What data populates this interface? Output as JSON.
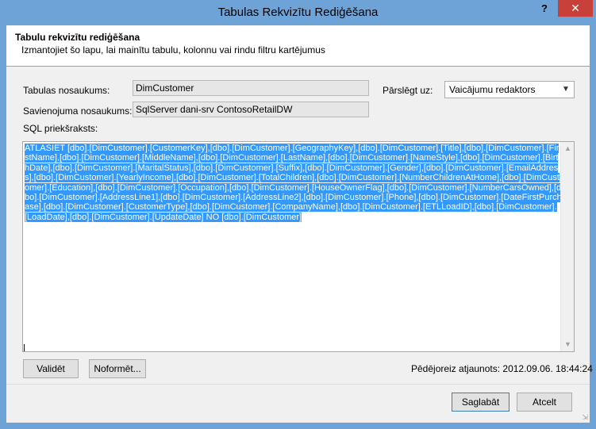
{
  "window": {
    "title": "Tabulas Rekvizītu Rediģēšana",
    "help_label": "?",
    "close_label": "✕"
  },
  "header": {
    "title": "Tabulu rekvizītu rediģēšana",
    "description": "Izmantojiet šo lapu, lai mainītu tabulu, kolonnu vai rindu filtru kartējumus"
  },
  "form": {
    "table_name_label": "Tabulas nosaukums:",
    "table_name_value": "DimCustomer",
    "connection_name_label": "Savienojuma nosaukums:",
    "connection_name_value": "SqlServer dani-srv ContosoRetailDW",
    "switch_label": "Pārslēgt uz:",
    "switch_value": "Vaicājumu redaktors",
    "sql_label": "SQL priekšraksts:",
    "sql_statement": "ATLASIET [dbo].[DimCustomer].[CustomerKey],[dbo].[DimCustomer].[GeographyKey],[dbo].[DimCustomer].[Title],[dbo].[DimCustomer].[FirstName],[dbo].[DimCustomer].[MiddleName],[dbo].[DimCustomer].[LastName],[dbo].[DimCustomer].[NameStyle],[dbo].[DimCustomer].[BirthDate],[dbo].[DimCustomer].[MaritalStatus],[dbo].[DimCustomer].[Suffix],[dbo].[DimCustomer].[Gender],[dbo].[DimCustomer].[EmailAddress],[dbo].[DimCustomer].[YearlyIncome],[dbo].[DimCustomer].[TotalChildren],[dbo].[DimCustomer].[NumberChildrenAtHome],[dbo].[DimCustomer].[Education],[dbo].[DimCustomer].[Occupation],[dbo].[DimCustomer].[HouseOwnerFlag],[dbo].[DimCustomer].[NumberCarsOwned],[dbo].[DimCustomer].[AddressLine1],[dbo].[DimCustomer].[AddressLine2],[dbo].[DimCustomer].[Phone],[dbo].[DimCustomer].[DateFirstPurchase],[dbo].[DimCustomer].[CustomerType],[dbo].[DimCustomer].[CompanyName],[dbo].[DimCustomer].[ETLLoadID],[dbo].[DimCustomer].[LoadDate],[dbo].[DimCustomer].[UpdateDate]                    NO [dbo].[DimCustomer]"
  },
  "buttons": {
    "validate": "Validēt",
    "format": "Noformēt...",
    "save": "Saglabāt",
    "cancel": "Atcelt"
  },
  "status": {
    "last_updated": "Pēdējoreiz atjaunots: 2012.09.06. 18:44:24"
  },
  "colors": {
    "titlebar": "#6ea3d8",
    "close_button": "#c7403a",
    "selection": "#3399ff"
  }
}
